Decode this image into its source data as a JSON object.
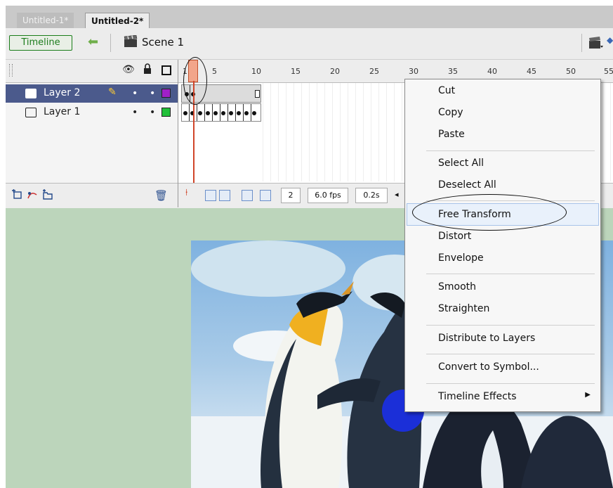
{
  "tabs": [
    {
      "label": "Untitled-1*",
      "active": false
    },
    {
      "label": "Untitled-2*",
      "active": true
    }
  ],
  "toolbar": {
    "timeline_label": "Timeline",
    "scene_label": "Scene 1"
  },
  "layers": [
    {
      "name": "Layer 2",
      "selected": true,
      "color": "#a020c8"
    },
    {
      "name": "Layer 1",
      "selected": false,
      "color": "#22c03a"
    }
  ],
  "ruler": {
    "ticks": [
      "1",
      "5",
      "10",
      "15",
      "20",
      "25",
      "30",
      "35",
      "40",
      "45",
      "50",
      "55"
    ]
  },
  "status": {
    "current_frame": "2",
    "frame_rate": "6.0 fps",
    "elapsed": "0.2s"
  },
  "context_menu": {
    "items": [
      {
        "label": "Cut"
      },
      {
        "label": "Copy"
      },
      {
        "label": "Paste"
      },
      {
        "label": "Select All"
      },
      {
        "label": "Deselect All"
      },
      {
        "label": "Free Transform",
        "highlighted": true
      },
      {
        "label": "Distort"
      },
      {
        "label": "Envelope"
      },
      {
        "label": "Smooth"
      },
      {
        "label": "Straighten"
      },
      {
        "label": "Distribute to Layers"
      },
      {
        "label": "Convert to Symbol..."
      },
      {
        "label": "Timeline Effects",
        "submenu": true
      }
    ]
  },
  "colors": {
    "selected_layer_bg": "#4b5a8c",
    "stage_bg": "#bcd5bb",
    "playhead": "#d0452a",
    "timeline_button": "#1e7d1e"
  }
}
